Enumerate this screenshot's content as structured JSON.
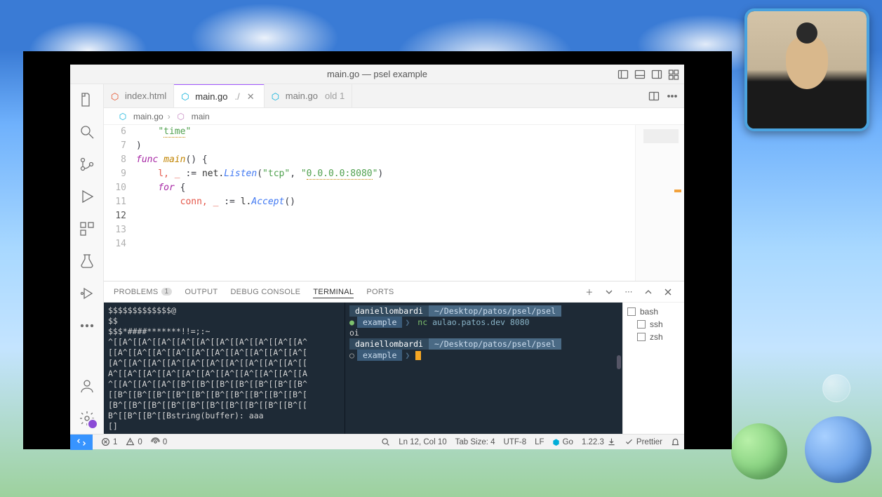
{
  "window_title": "main.go — psel example",
  "tabs": [
    {
      "icon": "html-file-icon",
      "label": "index.html",
      "suffix": "",
      "active": false,
      "dirty": false
    },
    {
      "icon": "go-file-icon",
      "label": "main.go",
      "suffix": "./",
      "active": true,
      "dirty": true
    },
    {
      "icon": "go-file-icon",
      "label": "main.go",
      "suffix": "old 1",
      "active": false,
      "dirty": false
    }
  ],
  "breadcrumb": {
    "file": "main.go",
    "symbol": "main"
  },
  "editor": {
    "lines": [
      {
        "n": 6,
        "tokens": [
          [
            "    ",
            null
          ],
          [
            "\"",
            "str"
          ],
          [
            "time",
            "str-u"
          ],
          [
            "\"",
            "str"
          ]
        ]
      },
      {
        "n": 7,
        "tokens": [
          [
            ")",
            "pun"
          ]
        ]
      },
      {
        "n": 8,
        "tokens": [
          [
            "",
            null
          ]
        ]
      },
      {
        "n": 9,
        "tokens": [
          [
            "func ",
            "kw"
          ],
          [
            "main",
            "typ"
          ],
          [
            "() {",
            "pun"
          ]
        ]
      },
      {
        "n": 10,
        "tokens": [
          [
            "    l, _ ",
            "ident"
          ],
          [
            ":= ",
            "pun"
          ],
          [
            "net.",
            null
          ],
          [
            "Listen",
            "fn"
          ],
          [
            "(",
            "pun"
          ],
          [
            "\"tcp\"",
            "str"
          ],
          [
            ", ",
            "pun"
          ],
          [
            "\"",
            "str"
          ],
          [
            "0.0.0.0:8080",
            "str-u"
          ],
          [
            "\"",
            "str"
          ],
          [
            ")",
            "pun"
          ]
        ]
      },
      {
        "n": 11,
        "tokens": [
          [
            "",
            null
          ]
        ]
      },
      {
        "n": 12,
        "tokens": [
          [
            "    ",
            null
          ],
          [
            "for ",
            "kw"
          ],
          [
            "{",
            "pun"
          ]
        ],
        "hl": true
      },
      {
        "n": 13,
        "tokens": [
          [
            "        conn, _ ",
            "ident"
          ],
          [
            ":= ",
            "pun"
          ],
          [
            "l.",
            null
          ],
          [
            "Accept",
            "fn"
          ],
          [
            "()",
            "pun"
          ]
        ]
      },
      {
        "n": 14,
        "tokens": [
          [
            "",
            null
          ]
        ]
      }
    ]
  },
  "panel": {
    "tabs": {
      "problems": "PROBLEMS",
      "problems_count": "1",
      "output": "OUTPUT",
      "debug": "DEBUG CONSOLE",
      "terminal": "TERMINAL",
      "ports": "PORTS"
    },
    "term_left": [
      "                          $$$$$$$$$$$$$@",
      "$$",
      "               $$$*####*******!!=;:~",
      "^[[A^[[A^[[A^[[A^[[A^[[A^[[A^[[A^[[A^[[A^",
      "[[A^[[A^[[A^[[A^[[A^[[A^[[A^[[A^[[A^[[A^[",
      "[A^[[A^[[A^[[A^[[A^[[A^[[A^[[A^[[A^[[A^[[",
      "A^[[A^[[A^[[A^[[A^[[A^[[A^[[A^[[A^[[A^[[A",
      "^[[A^[[A^[[A^[[B^[[B^[[B^[[B^[[B^[[B^[[B^",
      "[[B^[[B^[[B^[[B^[[B^[[B^[[B^[[B^[[B^[[B^[",
      "[B^[[B^[[B^[[B^[[B^[[B^[[B^[[B^[[B^[[B^[[",
      "B^[[B^[[B^[[Bstring(buffer): aaa",
      "[]"
    ],
    "term_right": {
      "user": "daniellombardi",
      "path": "~/Desktop/patos/psel/psel",
      "project": "example",
      "cmd1_bin": "nc",
      "cmd1_args": "aulao.patos.dev 8080",
      "output1": "oi"
    },
    "shells": [
      {
        "name": "bash",
        "indent": false
      },
      {
        "name": "ssh",
        "indent": true
      },
      {
        "name": "zsh",
        "indent": true
      }
    ]
  },
  "status": {
    "errors": "1",
    "warnings": "0",
    "ports": "0",
    "cursor": "Ln 12, Col 10",
    "tabsize": "Tab Size: 4",
    "encoding": "UTF-8",
    "eol": "LF",
    "lang": "Go",
    "go_ver": "1.22.3",
    "formatter": "Prettier"
  }
}
